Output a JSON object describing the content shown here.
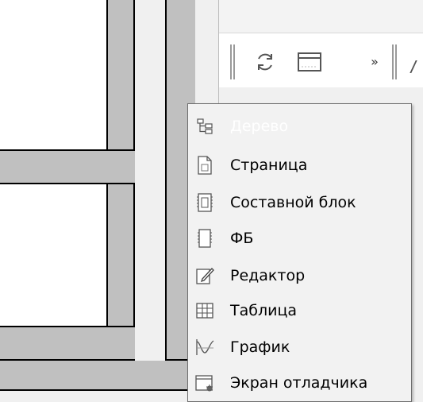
{
  "toolbar": {
    "refresh_icon": "refresh-icon",
    "window_icon": "window-icon",
    "overflow_label": "»"
  },
  "menu": {
    "items": [
      {
        "label": "Дерево",
        "icon": "tree-icon",
        "enabled": false
      },
      {
        "label": "Страница",
        "icon": "page-icon",
        "enabled": true
      },
      {
        "label": "Составной блок",
        "icon": "composite-block-icon",
        "enabled": true
      },
      {
        "label": "ФБ",
        "icon": "fb-icon",
        "enabled": true
      },
      {
        "label": "Редактор",
        "icon": "editor-icon",
        "enabled": true
      },
      {
        "label": "Таблица",
        "icon": "table-icon",
        "enabled": true
      },
      {
        "label": "График",
        "icon": "graph-icon",
        "enabled": true
      },
      {
        "label": "Экран отладчика",
        "icon": "debugger-screen-icon",
        "enabled": true
      }
    ]
  },
  "colors": {
    "panel_fill": "#ffffff",
    "bar_fill": "#c0c0c0",
    "menu_bg": "#f2f2f2",
    "disabled_text": "#ffffff"
  }
}
